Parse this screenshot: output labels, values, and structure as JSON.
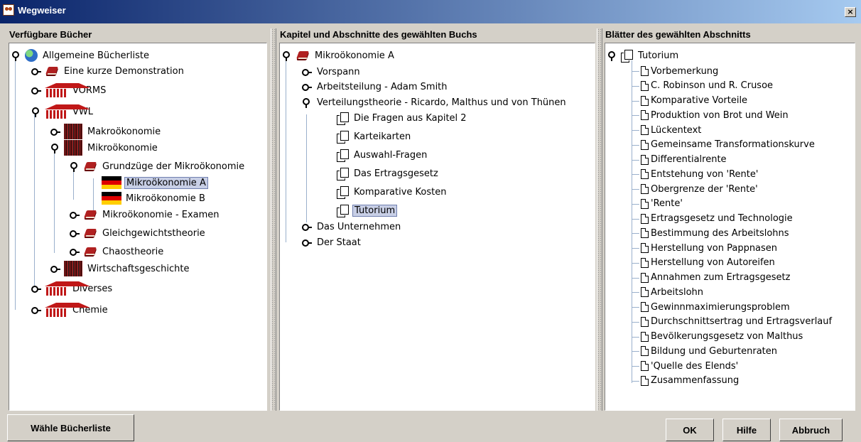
{
  "window": {
    "title": "Wegweiser",
    "close_label": "×"
  },
  "panes": {
    "books": {
      "header": "Verfügbare Bücher",
      "items": [
        {
          "label": "Allgemeine Bücherliste",
          "icon": "globe",
          "state": "expanded"
        },
        {
          "label": "Eine kurze Demonstration",
          "icon": "book",
          "state": "collapsed"
        },
        {
          "label": "VORMS",
          "icon": "library",
          "state": "collapsed"
        },
        {
          "label": "VWL",
          "icon": "library",
          "state": "expanded"
        },
        {
          "label": "Makroökonomie",
          "icon": "shelf",
          "state": "collapsed"
        },
        {
          "label": "Mikroökonomie",
          "icon": "shelf",
          "state": "expanded"
        },
        {
          "label": "Grundzüge der Mikroökonomie",
          "icon": "book",
          "state": "expanded"
        },
        {
          "label": "Mikroökonomie A",
          "icon": "flag-de",
          "state": "leaf",
          "selected": true
        },
        {
          "label": "Mikroökonomie B",
          "icon": "flag-de",
          "state": "leaf"
        },
        {
          "label": "Mikroökonomie - Examen",
          "icon": "book",
          "state": "collapsed"
        },
        {
          "label": "Gleichgewichtstheorie",
          "icon": "book",
          "state": "collapsed"
        },
        {
          "label": "Chaostheorie",
          "icon": "book",
          "state": "collapsed"
        },
        {
          "label": "Wirtschaftsgeschichte",
          "icon": "shelf",
          "state": "collapsed"
        },
        {
          "label": "Diverses",
          "icon": "library",
          "state": "collapsed"
        },
        {
          "label": "Chemie",
          "icon": "library",
          "state": "collapsed"
        }
      ]
    },
    "chapters": {
      "header": "Kapitel und Abschnitte des gewählten Buchs",
      "items": [
        {
          "label": "Mikroökonomie A",
          "icon": "book",
          "state": "expanded"
        },
        {
          "label": "Vorspann",
          "state": "collapsed"
        },
        {
          "label": "Arbeitsteilung - Adam Smith",
          "state": "collapsed"
        },
        {
          "label": "Verteilungstheorie - Ricardo, Malthus und von Thünen",
          "state": "expanded"
        },
        {
          "label": "Die Fragen aus Kapitel 2",
          "icon": "pages"
        },
        {
          "label": "Karteikarten",
          "icon": "pages"
        },
        {
          "label": "Auswahl-Fragen",
          "icon": "pages"
        },
        {
          "label": "Das Ertragsgesetz",
          "icon": "pages"
        },
        {
          "label": "Komparative Kosten",
          "icon": "pages"
        },
        {
          "label": "Tutorium",
          "icon": "pages",
          "selected": true
        },
        {
          "label": "Das Unternehmen",
          "state": "collapsed"
        },
        {
          "label": "Der Staat",
          "state": "collapsed"
        }
      ]
    },
    "sheets": {
      "header": "Blätter des gewählten Abschnitts",
      "root": "Tutorium",
      "items": [
        "Vorbemerkung",
        "C. Robinson und R. Crusoe",
        "Komparative Vorteile",
        "Produktion von Brot und Wein",
        "Lückentext",
        "Gemeinsame Transformationskurve",
        "Differentialrente",
        "Entstehung von 'Rente'",
        "Obergrenze der 'Rente'",
        "'Rente'",
        "Ertragsgesetz  und Technologie",
        "Bestimmung des Arbeitslohns",
        "Herstellung von Pappnasen",
        "Herstellung von Autoreifen",
        "Annahmen zum Ertragsgesetz",
        "Arbeitslohn",
        "Gewinnmaximierungsproblem",
        "Durchschnittsertrag  und Ertragsverlauf",
        "Bevölkerungsgesetz von Malthus",
        "Bildung und Geburtenraten",
        "'Quelle des Elends'",
        "Zusammenfassung"
      ]
    }
  },
  "buttons": {
    "choose_list": "Wähle Bücherliste",
    "ok": "OK",
    "help": "Hilfe",
    "cancel": "Abbruch"
  },
  "colors": {
    "title_bar": "#0a246a",
    "selection": "#c8cfe6",
    "window_bg": "#d4d0c8",
    "tree_line": "#9ab0cc"
  }
}
